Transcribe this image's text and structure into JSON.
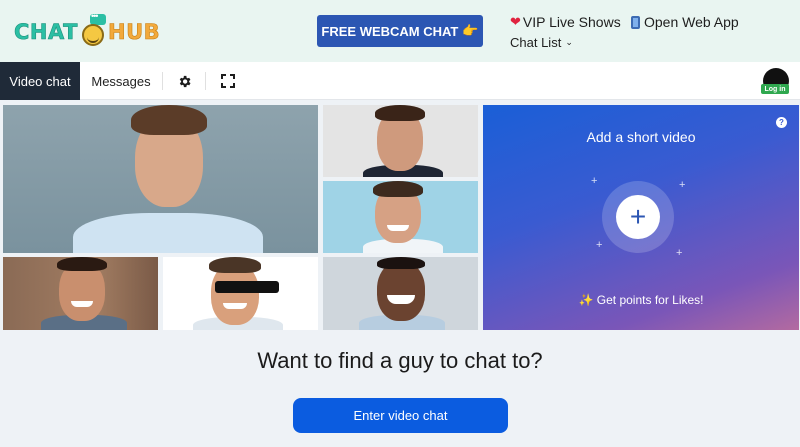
{
  "header": {
    "logo": {
      "text_1": "CHAT",
      "text_2": "HUB"
    },
    "cta_label": "FREE WEBCAM CHAT",
    "cta_emoji": "👉",
    "vip_label": "VIP Live Shows",
    "app_label": "Open Web App",
    "chat_list_label": "Chat List"
  },
  "toolbar": {
    "tabs": [
      {
        "label": "Video chat",
        "active": true
      },
      {
        "label": "Messages",
        "active": false
      }
    ],
    "icons": [
      "gear-icon",
      "fullscreen-icon"
    ],
    "login_label": "Log in"
  },
  "promo": {
    "title": "Add a short video",
    "help": "?",
    "plus": "+",
    "footer_emoji": "✨",
    "footer": "Get points for Likes!"
  },
  "main": {
    "headline": "Want to find a guy to chat to?",
    "button_label": "Enter video chat"
  },
  "colors": {
    "header_bg": "#e9f5f1",
    "cta_bg": "#2c56b3",
    "tab_active_bg": "#1f2a38",
    "button_bg": "#0b5ce0",
    "login_badge": "#2fa84f"
  }
}
